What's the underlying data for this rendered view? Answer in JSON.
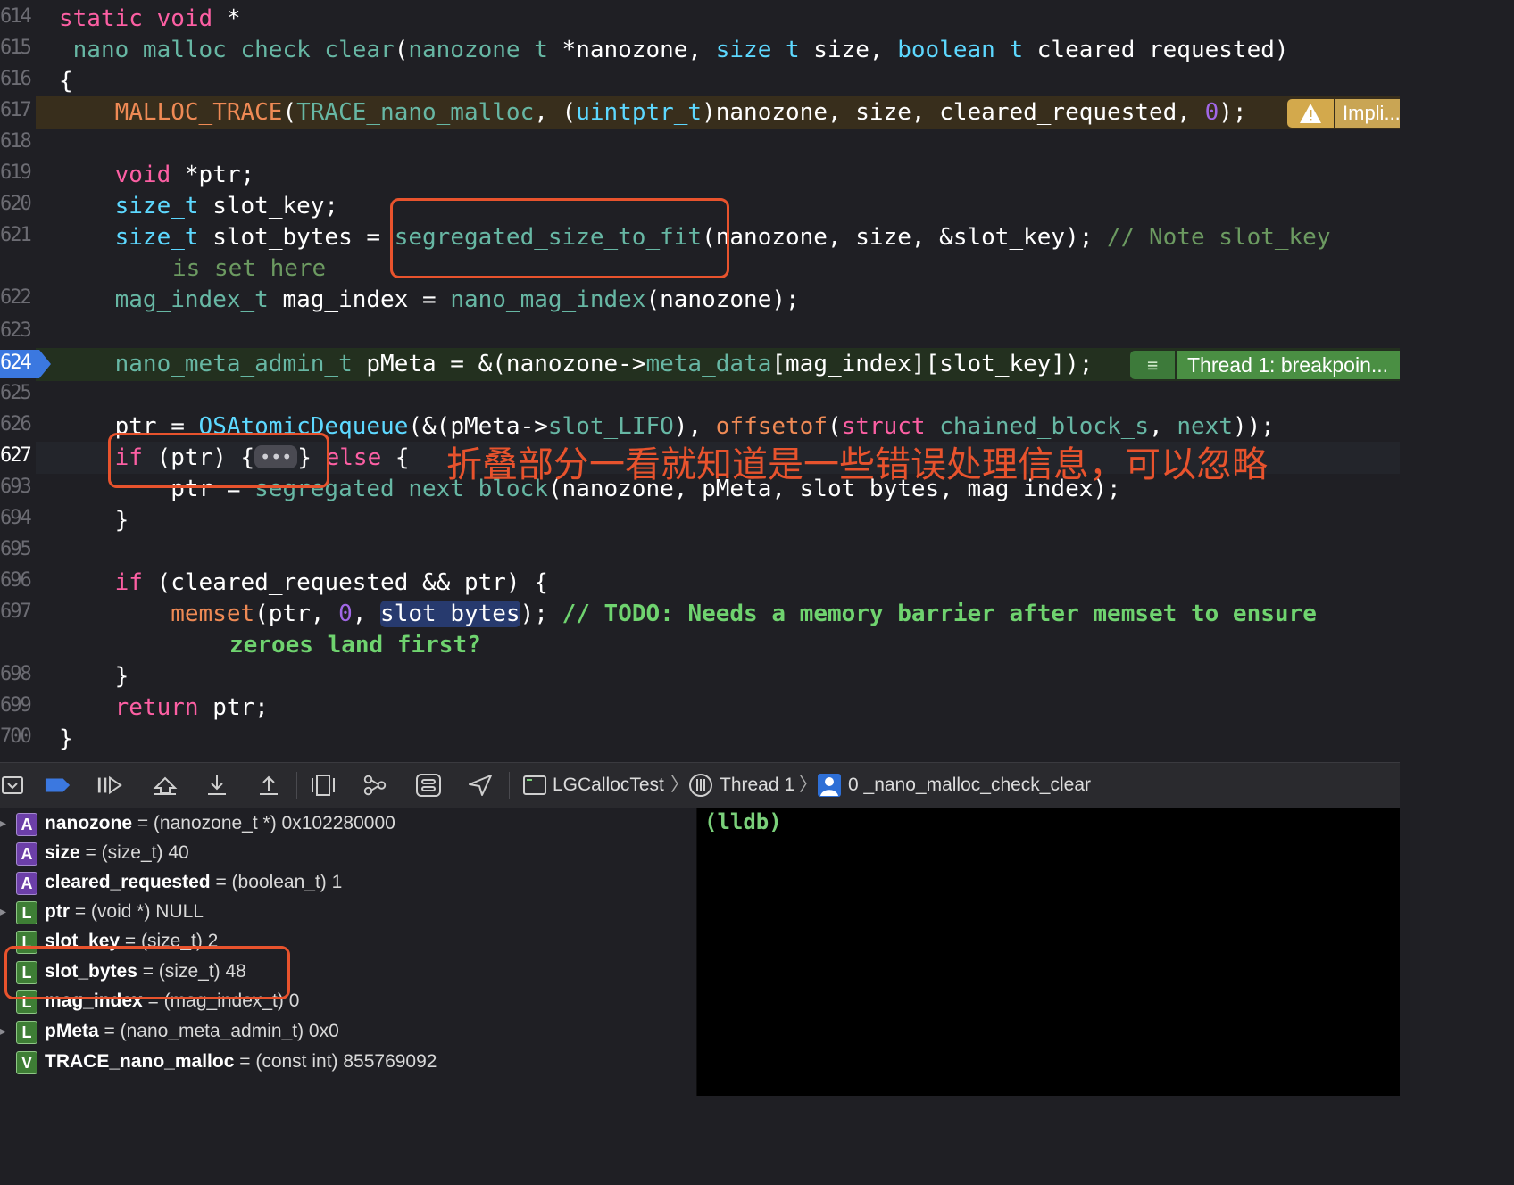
{
  "editor": {
    "lines": [
      {
        "num": "614"
      },
      {
        "num": "615"
      },
      {
        "num": "616"
      },
      {
        "num": "617"
      },
      {
        "num": "618"
      },
      {
        "num": "619"
      },
      {
        "num": "620"
      },
      {
        "num": "621"
      },
      {
        "num": "622"
      },
      {
        "num": "623"
      },
      {
        "num": "624"
      },
      {
        "num": "625"
      },
      {
        "num": "626"
      },
      {
        "num": "627"
      },
      {
        "num": "693"
      },
      {
        "num": "694"
      },
      {
        "num": "695"
      },
      {
        "num": "696"
      },
      {
        "num": "697"
      },
      {
        "num": "698"
      },
      {
        "num": "699"
      },
      {
        "num": "700"
      }
    ],
    "code": {
      "l614a": "static",
      "l614b": " ",
      "l614c": "void",
      "l614d": " *",
      "l615a": "_nano_malloc_check_clear",
      "l615b": "(",
      "l615c": "nanozone_t",
      "l615d": " *nanozone, ",
      "l615e": "size_t",
      "l615f": " size, ",
      "l615g": "boolean_t",
      "l615h": " cleared_requested)",
      "l616": "{",
      "l617a": "    ",
      "l617b": "MALLOC_TRACE",
      "l617c": "(",
      "l617d": "TRACE_nano_malloc",
      "l617e": ", (",
      "l617f": "uintptr_t",
      "l617g": ")nanozone, size, cleared_requested, ",
      "l617h": "0",
      "l617i": ");",
      "l619a": "    ",
      "l619b": "void",
      "l619c": " *ptr;",
      "l620a": "    ",
      "l620b": "size_t",
      "l620c": " slot_key;",
      "l621a": "    ",
      "l621b": "size_t",
      "l621c": " slot_bytes = ",
      "l621d": "segregated_size_to_fit",
      "l621e": "(nanozone, size, &slot_key); ",
      "l621f": "// Note slot_key",
      "l621cont": "is set here",
      "l622a": "    ",
      "l622b": "mag_index_t",
      "l622c": " mag_index = ",
      "l622d": "nano_mag_index",
      "l622e": "(nanozone);",
      "l624a": "    ",
      "l624b": "nano_meta_admin_t",
      "l624c": " pMeta = &(nanozone->",
      "l624d": "meta_data",
      "l624e": "[mag_index][slot_key]);",
      "l626a": "    ptr = ",
      "l626b": "OSAtomicDequeue",
      "l626c": "(&(pMeta->",
      "l626d": "slot_LIFO",
      "l626e": "), ",
      "l626f": "offsetof",
      "l626g": "(",
      "l626h": "struct",
      "l626i": " ",
      "l626j": "chained_block_s",
      "l626k": ", ",
      "l626l": "next",
      "l626m": "));",
      "l627a": "    ",
      "l627b": "if",
      "l627c": " (ptr) {",
      "l627fold": "•••",
      "l627d": "} ",
      "l627e": "else",
      "l627f": " {",
      "l693a": "        ptr = ",
      "l693b": "segregated_next_block",
      "l693c": "(nanozone, pMeta, slot_bytes, mag_index);",
      "l694": "    }",
      "l696a": "    ",
      "l696b": "if",
      "l696c": " (cleared_requested && ptr) {",
      "l697a": "        ",
      "l697b": "memset",
      "l697c": "(ptr, ",
      "l697d": "0",
      "l697e": ", ",
      "l697f": "slot_bytes",
      "l697g": "); ",
      "l697h": "// TODO: Needs a memory barrier after memset to ensure",
      "l697cont": "zeroes land first?",
      "l698": "    }",
      "l699a": "    ",
      "l699b": "return",
      "l699c": " ptr;",
      "l700": "}"
    },
    "warning_label": "Impli...",
    "breakpoint_label": "Thread 1: breakpoin...",
    "annotation": "折叠部分一看就知道是一些错误处理信息，可以忽略"
  },
  "debug_bar": {
    "target": "LGCallocTest",
    "thread": "Thread 1",
    "frame": "0 _nano_malloc_check_clear"
  },
  "variables": [
    {
      "kind": "A",
      "name": "nanozone",
      "rest": " = (nanozone_t *) 0x102280000",
      "expandable": true
    },
    {
      "kind": "A",
      "name": "size",
      "rest": " = (size_t) 40",
      "expandable": false
    },
    {
      "kind": "A",
      "name": "cleared_requested",
      "rest": " = (boolean_t) 1",
      "expandable": false
    },
    {
      "kind": "L",
      "name": "ptr",
      "rest": " = (void *) NULL",
      "expandable": true
    },
    {
      "kind": "L",
      "name": "slot_key",
      "rest": " = (size_t) 2",
      "expandable": false
    },
    {
      "kind": "L",
      "name": "slot_bytes",
      "rest": " = (size_t) 48",
      "expandable": false
    },
    {
      "kind": "L",
      "name": "mag_index",
      "rest": " = (mag_index_t) 0",
      "expandable": false
    },
    {
      "kind": "L",
      "name": "pMeta",
      "rest": " = (nano_meta_admin_t) 0x0",
      "expandable": true
    },
    {
      "kind": "V",
      "name": "TRACE_nano_malloc",
      "rest": " = (const int) 855769092",
      "expandable": false
    }
  ],
  "console": {
    "prompt": "(lldb)"
  },
  "colors": {
    "annotation": "#e8532d",
    "breakpoint": "#4a8f43",
    "warning": "#d3a94c"
  }
}
